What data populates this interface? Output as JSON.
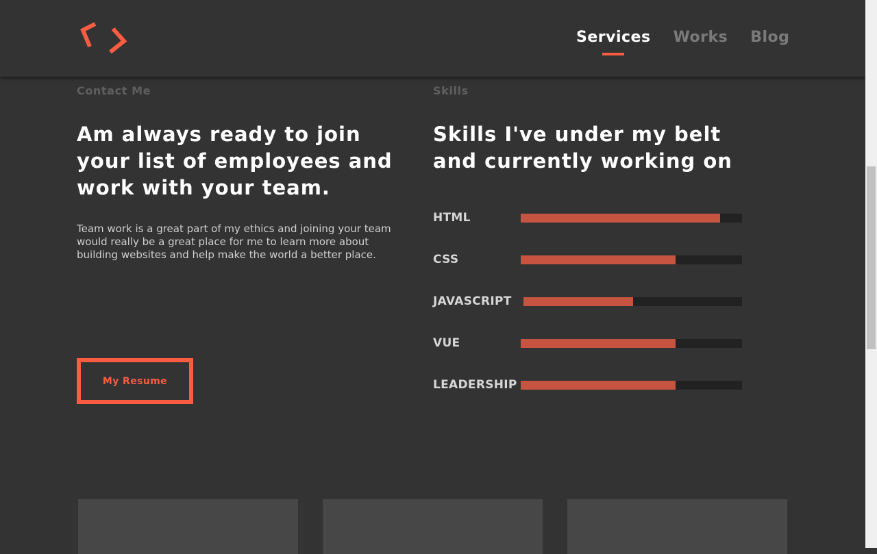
{
  "nav": {
    "items": [
      {
        "label": "Services",
        "active": true
      },
      {
        "label": "Works",
        "active": false
      },
      {
        "label": "Blog",
        "active": false
      }
    ]
  },
  "contact": {
    "label": "Contact Me",
    "heading": "Am always ready to join your list of employees and work with your team.",
    "body": "Team work is a great part of my ethics and joining your team would really be a great place for me to learn more about building websites and help make the world a better place.",
    "button": "My Resume"
  },
  "skills": {
    "label": "Skills",
    "heading": "Skills I've under my belt and currently working on",
    "items": [
      {
        "name": "HTML",
        "level": 0.9
      },
      {
        "name": "CSS",
        "level": 0.7
      },
      {
        "name": "JAVASCRIPT",
        "level": 0.5
      },
      {
        "name": "VUE",
        "level": 0.7
      },
      {
        "name": "LEADERSHIP",
        "level": 0.7
      }
    ]
  },
  "colors": {
    "accent": "#fa5c42",
    "bar_fill": "#c65441",
    "bar_track": "#222222",
    "background": "#333333"
  }
}
